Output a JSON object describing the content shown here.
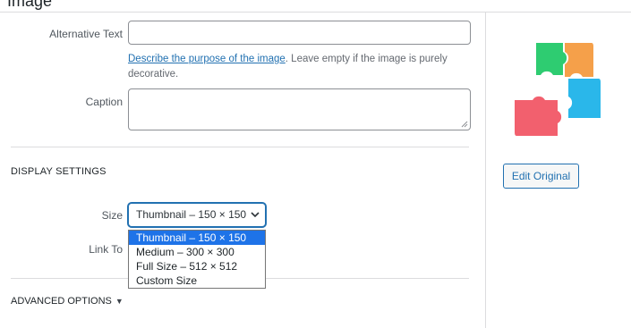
{
  "header": {
    "title_fragment": "Image"
  },
  "fields": {
    "alt_text": {
      "label": "Alternative Text",
      "value": ""
    },
    "help": {
      "link": "Describe the purpose of the image",
      "rest": ". Leave empty if the image is purely decorative."
    },
    "caption": {
      "label": "Caption",
      "value": ""
    }
  },
  "display_settings": {
    "title": "DISPLAY SETTINGS",
    "size_label": "Size",
    "size_selected": "Thumbnail – 150 × 150",
    "size_options": [
      "Thumbnail – 150 × 150",
      "Medium – 300 × 300",
      "Full Size – 512 × 512",
      "Custom Size"
    ],
    "link_to_label": "Link To"
  },
  "advanced": {
    "label": "ADVANCED OPTIONS",
    "toggle_icon": "▼"
  },
  "preview": {
    "image": "puzzle-image",
    "edit_button": "Edit Original"
  },
  "colors": {
    "accent": "#2271b1",
    "selected_option": "#1e73e8",
    "puzzle_green": "#2ecc71",
    "puzzle_orange": "#f5a04a",
    "puzzle_blue": "#2ab7ea",
    "puzzle_pink": "#f2606e"
  }
}
